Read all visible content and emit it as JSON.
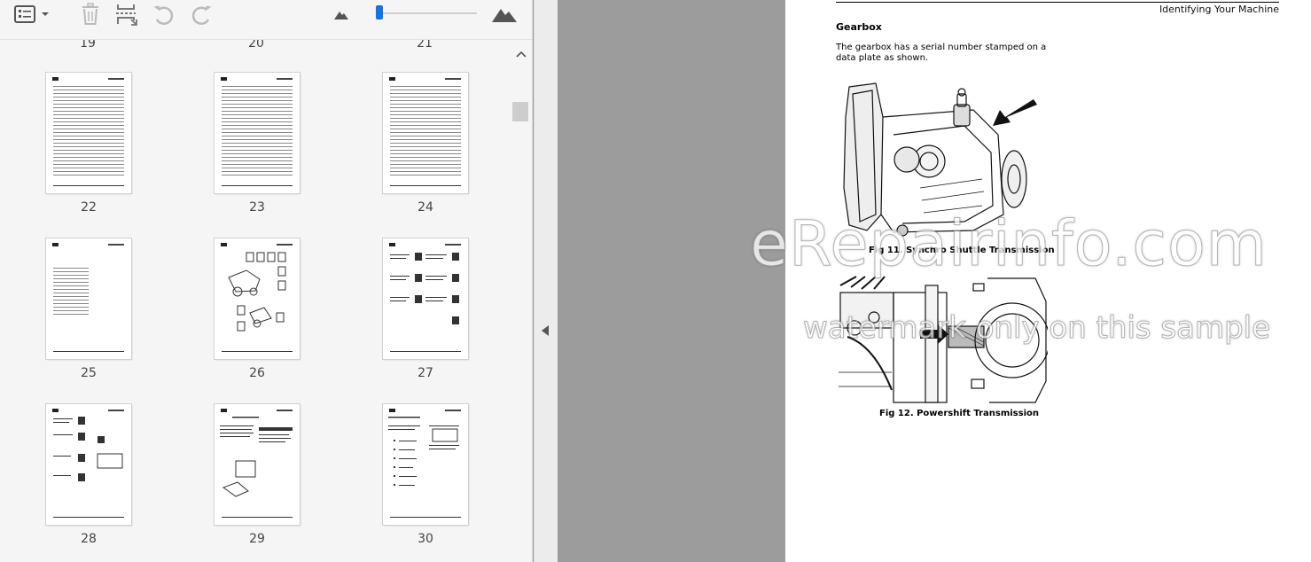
{
  "toolbar": {
    "icons": [
      "thumbnail-options-icon",
      "chevron-down-icon",
      "delete-icon",
      "extract-icon",
      "undo-icon",
      "redo-icon",
      "mountain-small-icon",
      "mountain-large-icon"
    ],
    "zoom_slider_level": 0.0,
    "accent_color": "#1473e6"
  },
  "thumbnails": {
    "partial_top_labels": [
      "19",
      "20",
      "21"
    ],
    "pages": [
      {
        "label": "22"
      },
      {
        "label": "23"
      },
      {
        "label": "24"
      },
      {
        "label": "25"
      },
      {
        "label": "26"
      },
      {
        "label": "27"
      },
      {
        "label": "28"
      },
      {
        "label": "29"
      },
      {
        "label": "30"
      }
    ]
  },
  "document": {
    "running_header": "Identifying Your Machine",
    "section_title": "Gearbox",
    "paragraph": "The gearbox has a serial number stamped on a data plate as shown.",
    "figures": [
      {
        "caption": "Fig 11. Synchro Shuttle Transmission"
      },
      {
        "caption": "Fig 12. Powershift Transmission"
      }
    ]
  },
  "watermark": {
    "line1": "eRepairinfo.com",
    "line2": "watermark only on this sample"
  }
}
